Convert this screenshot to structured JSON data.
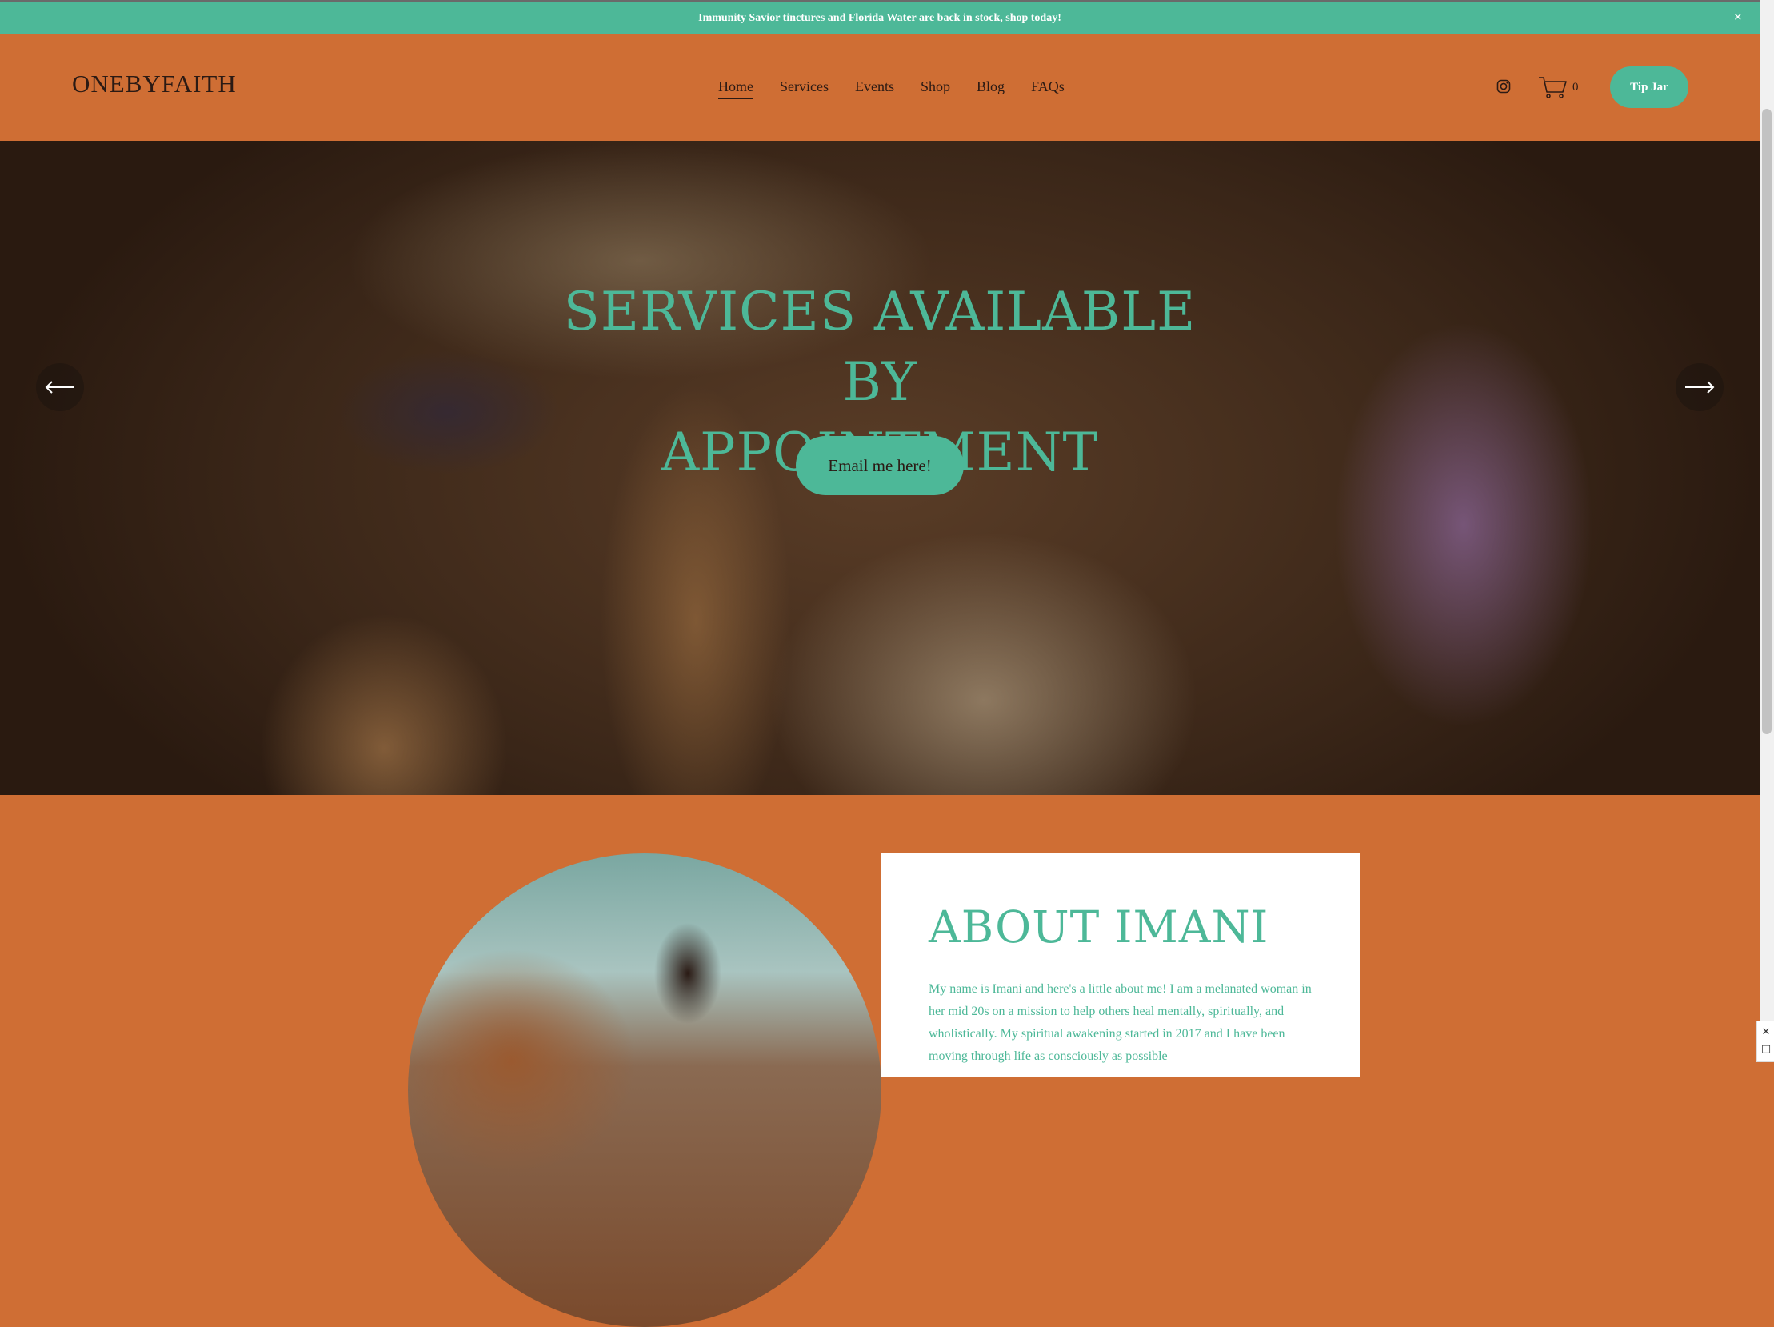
{
  "announcement": {
    "text": "Immunity Savior tinctures and Florida Water are back in stock, shop today!",
    "close": "×"
  },
  "header": {
    "logo": "ONEBYFAITH",
    "nav": [
      "Home",
      "Services",
      "Events",
      "Shop",
      "Blog",
      "FAQs"
    ],
    "active_nav": "Home",
    "cart_count": "0",
    "tip_jar": "Tip Jar"
  },
  "hero": {
    "title_line1": "SERVICES AVAILABLE BY",
    "title_line2": "APPOINTMENT",
    "button": "Email me here!"
  },
  "about": {
    "title": "ABOUT IMANI",
    "text": "My name is Imani and here's a little about me! I am a melanated woman in her mid 20s on a mission to help others heal mentally, spiritually, and wholistically. My spiritual awakening started in 2017 and I have been moving through life as consciously as possible"
  },
  "widget": {
    "close": "✕",
    "icon": "□"
  },
  "colors": {
    "accent": "#4db898",
    "brand_orange": "#cf6e34",
    "text_dark": "#2b1a14"
  },
  "icons": [
    "close-icon",
    "instagram-icon",
    "cart-icon",
    "arrow-left-icon",
    "arrow-right-icon"
  ]
}
